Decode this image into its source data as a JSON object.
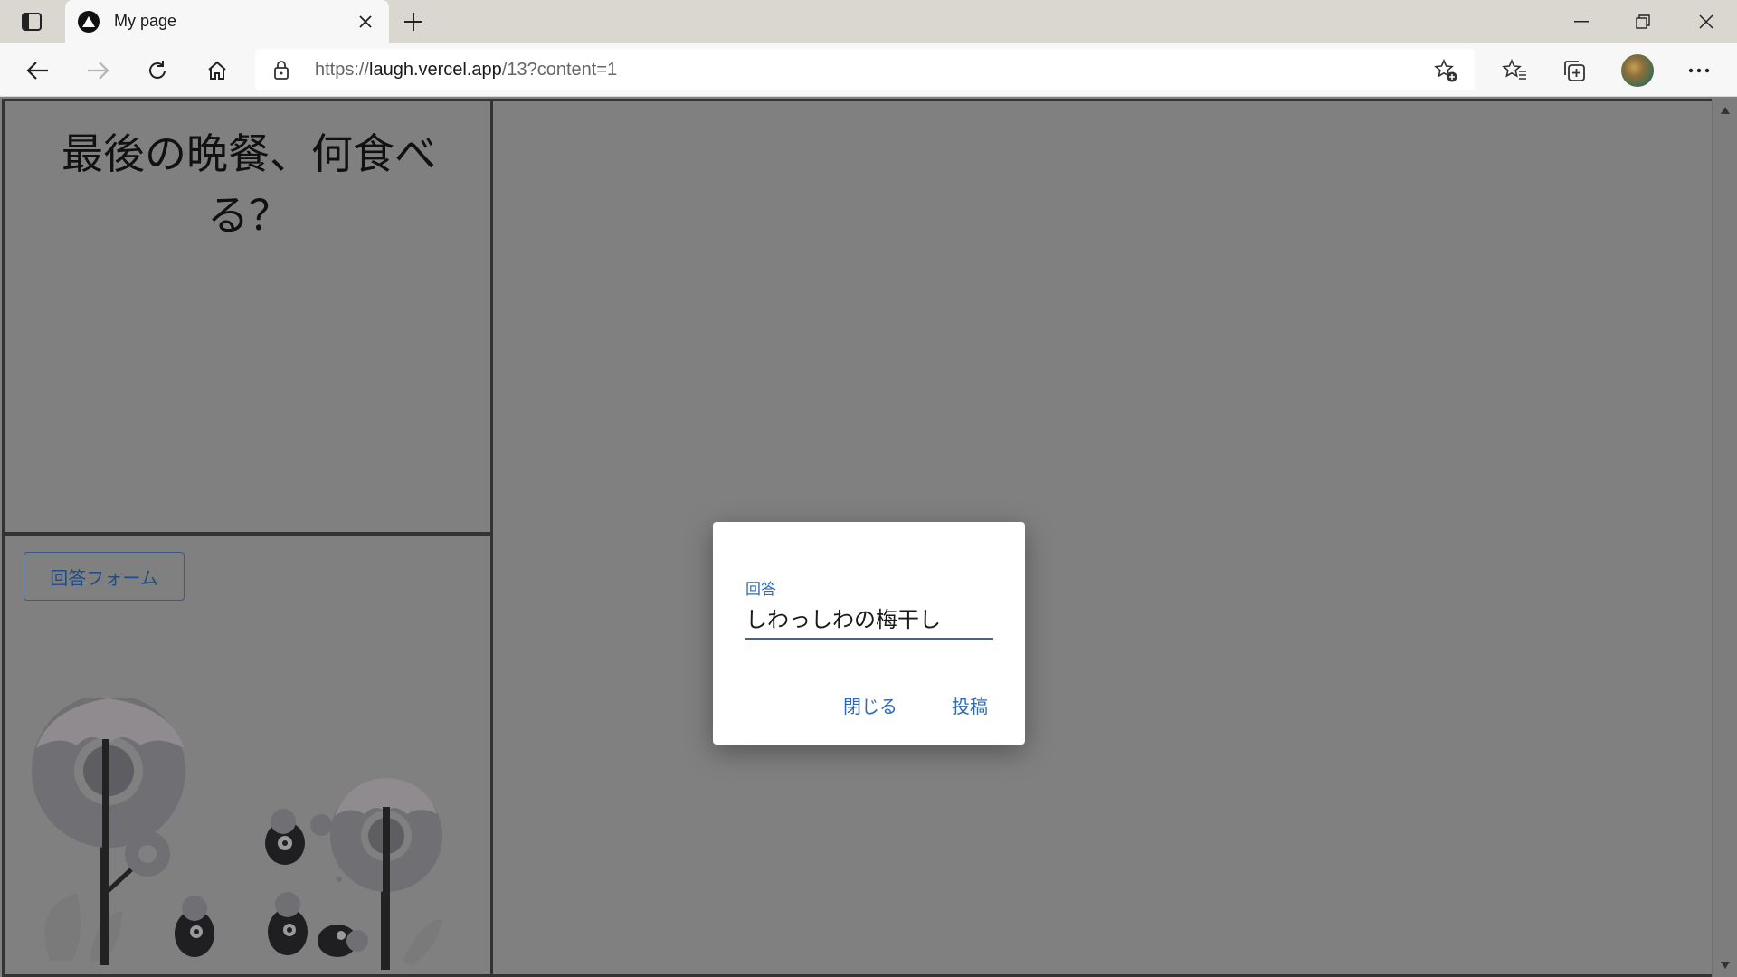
{
  "browser": {
    "tab_title": "My page",
    "url_prefix": "https://",
    "url_host": "laugh.vercel.app",
    "url_path": "/13?content=1"
  },
  "page": {
    "question": "最後の晩餐、何食べる？",
    "answer_form_button": "回答フォーム"
  },
  "dialog": {
    "field_label": "回答",
    "field_value": "しわっしわの梅干し",
    "close_button": "閉じる",
    "post_button": "投稿"
  },
  "colors": {
    "accent": "#2d6bb8",
    "backdrop": "#808080",
    "form_button_text": "#1f4b8f"
  },
  "icons": {
    "tab_actions": "tab-actions-icon",
    "favicon": "vercel-triangle-icon",
    "close_tab": "close-icon",
    "new_tab": "plus-icon",
    "back": "back-arrow-icon",
    "forward": "forward-arrow-icon",
    "refresh": "refresh-icon",
    "home": "home-icon",
    "lock": "lock-icon",
    "add_favorite": "star-add-icon",
    "favorites": "favorites-icon",
    "collections": "collections-icon",
    "more": "more-icon"
  }
}
